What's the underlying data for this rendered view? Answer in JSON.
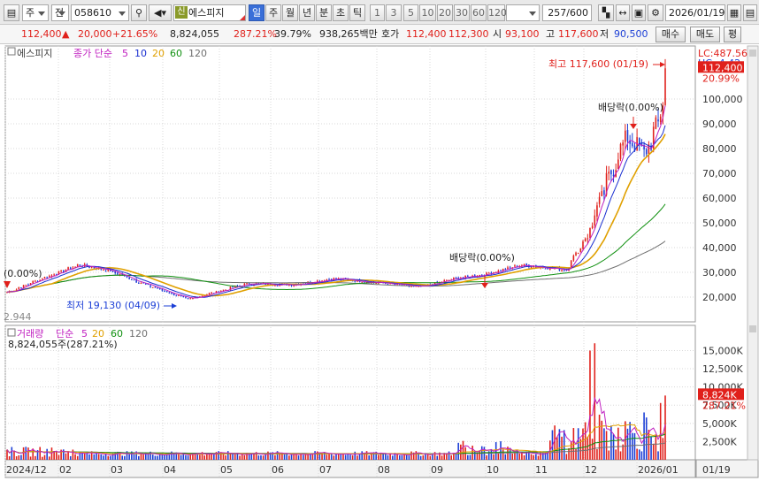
{
  "toolbar": {
    "market_select": "주",
    "type_select": "전",
    "code": "058610",
    "sin_badge": "신",
    "name": "에스피지",
    "periods": [
      "일",
      "주",
      "월",
      "년",
      "분",
      "초",
      "틱"
    ],
    "active_period": "일",
    "ticks": [
      "1",
      "3",
      "5",
      "10",
      "20",
      "30",
      "60",
      "120"
    ],
    "count_value": "257",
    "count_total": "/600",
    "date": "2026/01/19"
  },
  "quote": {
    "price": "112,400",
    "change": "20,000",
    "change_pct": "+21.65%",
    "volume": "8,824,055",
    "volume_ratio": "287.21%",
    "turnover_rate": "39.79%",
    "amount": "938,265백만",
    "hoga_label": "호가",
    "ask": "112,400",
    "bid": "112,300",
    "open_label": "시",
    "open": "93,100",
    "high_label": "고",
    "high": "117,600",
    "low_label": "저",
    "low": "90,500",
    "buy_label": "매수",
    "sell_label": "매도",
    "eval_label": "평"
  },
  "colors": {
    "up": "#e0201b",
    "down": "#1c3fd6",
    "ma5": "#c020c0",
    "ma10": "#1a2fd0",
    "ma20": "#e0a000",
    "ma60": "#109010",
    "ma120": "#707070"
  },
  "price_panel": {
    "legend_name": "에스피지",
    "legend_label": "종가 단순",
    "ma_periods": [
      "5",
      "10",
      "20",
      "60",
      "120"
    ],
    "lc_label": "LC:487.56",
    "hc_label": "HC:-4.42",
    "current_price_label": "112,400",
    "current_change_label": "20.99%",
    "high_annotation": "최고 117,600 (01/19)",
    "low_annotation": "최저 19,130 (04/09)",
    "start_annotation": "(0.00%)",
    "dividend_label_1": "배당락(0.00%)",
    "dividend_label_2": "배당락(0.00%)",
    "y_ticks": [
      "100,000",
      "90,000",
      "80,000",
      "70,000",
      "60,000",
      "50,000",
      "40,000",
      "30,000",
      "20,000"
    ],
    "bottom_label": "2.944"
  },
  "volume_panel": {
    "legend_label": "거래량",
    "legend_ma_label": "단순",
    "ma_periods": [
      "5",
      "20",
      "60",
      "120"
    ],
    "sub_legend": "8,824,055주(287.21%)",
    "current_label": "8,824K",
    "current_pct": "287.21%",
    "y_ticks": [
      "15,000K",
      "12,500K",
      "10,000K",
      "7,500K",
      "5,000K",
      "2,500K"
    ]
  },
  "x_axis": {
    "labels": [
      "2024/12",
      "02",
      "03",
      "04",
      "05",
      "06",
      "07",
      "08",
      "09",
      "10",
      "11",
      "12",
      "2026/01"
    ],
    "right_label": "01/19"
  },
  "chart_data": {
    "type": "candlestick",
    "title": "에스피지",
    "price_ylim": [
      15000,
      120000
    ],
    "volume_ylim": [
      0,
      17000
    ],
    "months": [
      "2024/12",
      "2025/01",
      "2025/02",
      "2025/03",
      "2025/04",
      "2025/05",
      "2025/06",
      "2025/07",
      "2025/08",
      "2025/09",
      "2025/10",
      "2025/11",
      "2025/12",
      "2026/01"
    ],
    "close_keypoints": [
      {
        "date": "2024/12/23",
        "close": 22000
      },
      {
        "date": "2025/01/10",
        "close": 27000
      },
      {
        "date": "2025/02/03",
        "close": 33000
      },
      {
        "date": "2025/02/20",
        "close": 31000
      },
      {
        "date": "2025/03/15",
        "close": 25000
      },
      {
        "date": "2025/04/09",
        "close": 19130
      },
      {
        "date": "2025/04/25",
        "close": 22000
      },
      {
        "date": "2025/05/15",
        "close": 25500
      },
      {
        "date": "2025/06/10",
        "close": 25000
      },
      {
        "date": "2025/07/05",
        "close": 27500
      },
      {
        "date": "2025/08/05",
        "close": 25500
      },
      {
        "date": "2025/08/25",
        "close": 24000
      },
      {
        "date": "2025/09/15",
        "close": 27500
      },
      {
        "date": "2025/10/01",
        "close": 29000
      },
      {
        "date": "2025/10/25",
        "close": 33000
      },
      {
        "date": "2025/11/20",
        "close": 31000
      },
      {
        "date": "2025/12/03",
        "close": 45000
      },
      {
        "date": "2025/12/12",
        "close": 62000
      },
      {
        "date": "2025/12/26",
        "close": 85000
      },
      {
        "date": "2026/01/06",
        "close": 78000
      },
      {
        "date": "2026/01/14",
        "close": 90000
      },
      {
        "date": "2026/01/19",
        "close": 112400
      }
    ],
    "volume_keypoints_k": [
      {
        "date": "2024/12",
        "volume": 1500
      },
      {
        "date": "2025/02",
        "volume": 2000
      },
      {
        "date": "2025/04",
        "volume": 800
      },
      {
        "date": "2025/07",
        "volume": 400
      },
      {
        "date": "2025/10",
        "volume": 2500
      },
      {
        "date": "2025/12/03",
        "volume": 15000
      },
      {
        "date": "2025/12/05",
        "volume": 16000
      },
      {
        "date": "2026/01/19",
        "volume": 8824
      }
    ]
  }
}
